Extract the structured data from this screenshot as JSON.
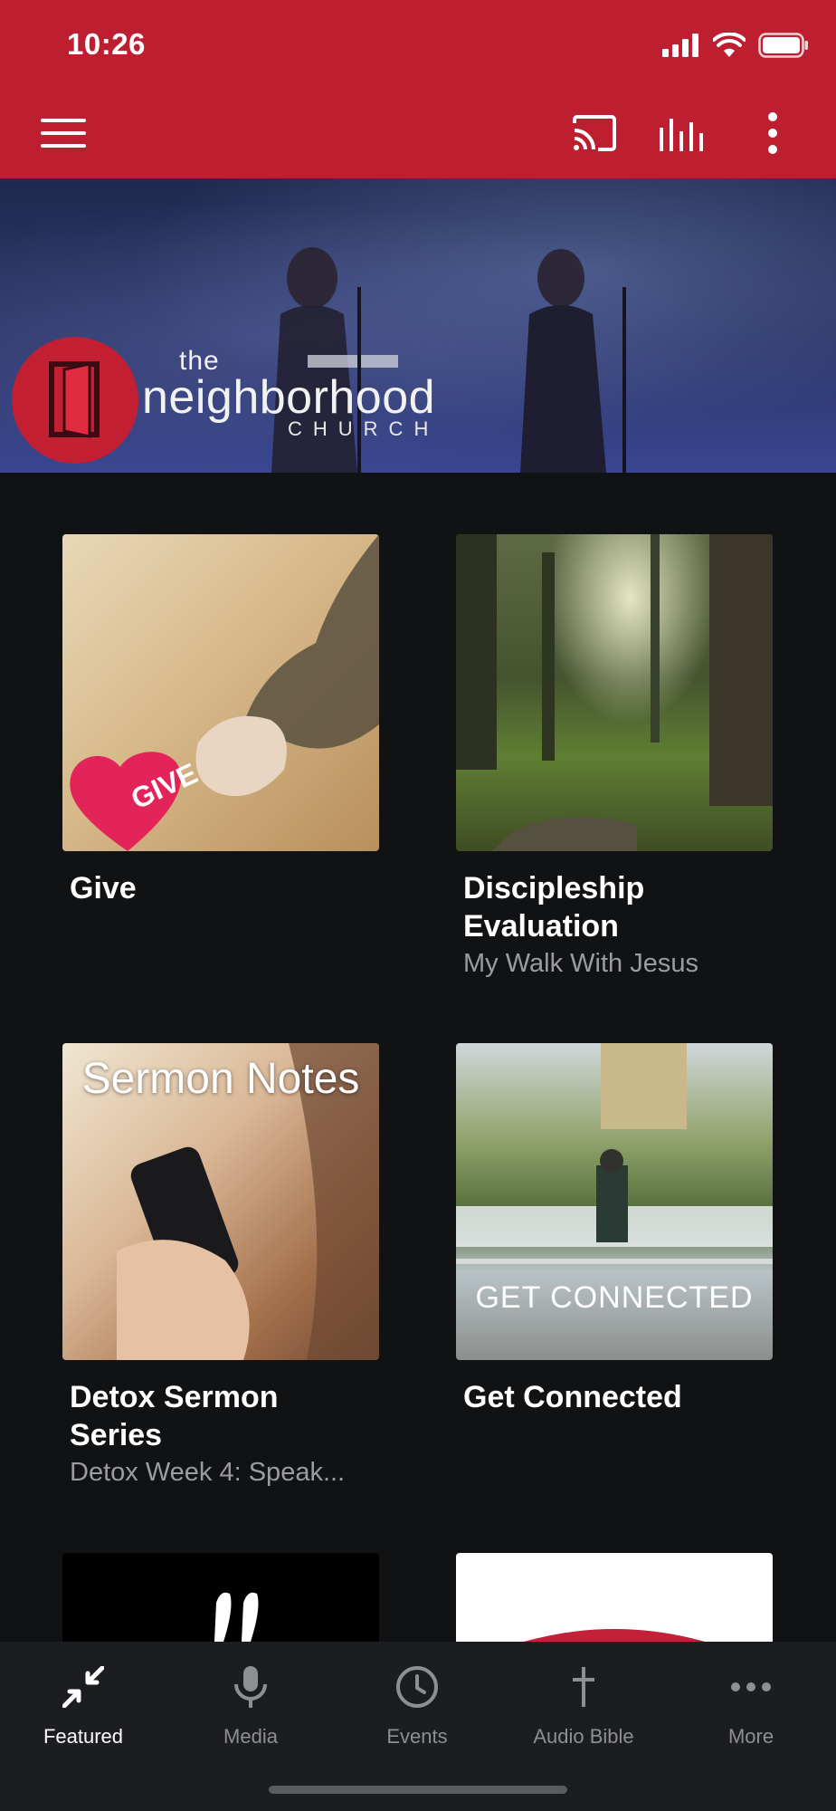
{
  "status_bar": {
    "time": "10:26"
  },
  "banner": {
    "brand_the": "the",
    "brand_name": "neighborhood",
    "brand_church": "CHURCH"
  },
  "cards": [
    {
      "title": "Give",
      "subtitle": "",
      "overlay": "GIVE"
    },
    {
      "title": "Discipleship Evaluation",
      "subtitle": "My Walk With Jesus",
      "overlay": ""
    },
    {
      "title": "Detox Sermon Series",
      "subtitle": "Detox Week 4: Speak...",
      "overlay": "Sermon Notes"
    },
    {
      "title": "Get Connected",
      "subtitle": "",
      "overlay": "GET CONNECTED"
    }
  ],
  "tabs": [
    {
      "label": "Featured",
      "icon": "featured-icon",
      "active": true
    },
    {
      "label": "Media",
      "icon": "microphone-icon",
      "active": false
    },
    {
      "label": "Events",
      "icon": "clock-icon",
      "active": false
    },
    {
      "label": "Audio Bible",
      "icon": "cross-icon",
      "active": false
    },
    {
      "label": "More",
      "icon": "more-dots-icon",
      "active": false
    }
  ],
  "colors": {
    "brand_red": "#bd1f30",
    "background": "#111214",
    "tabbar": "#1c1d20",
    "muted_text": "#9b9ca0"
  }
}
